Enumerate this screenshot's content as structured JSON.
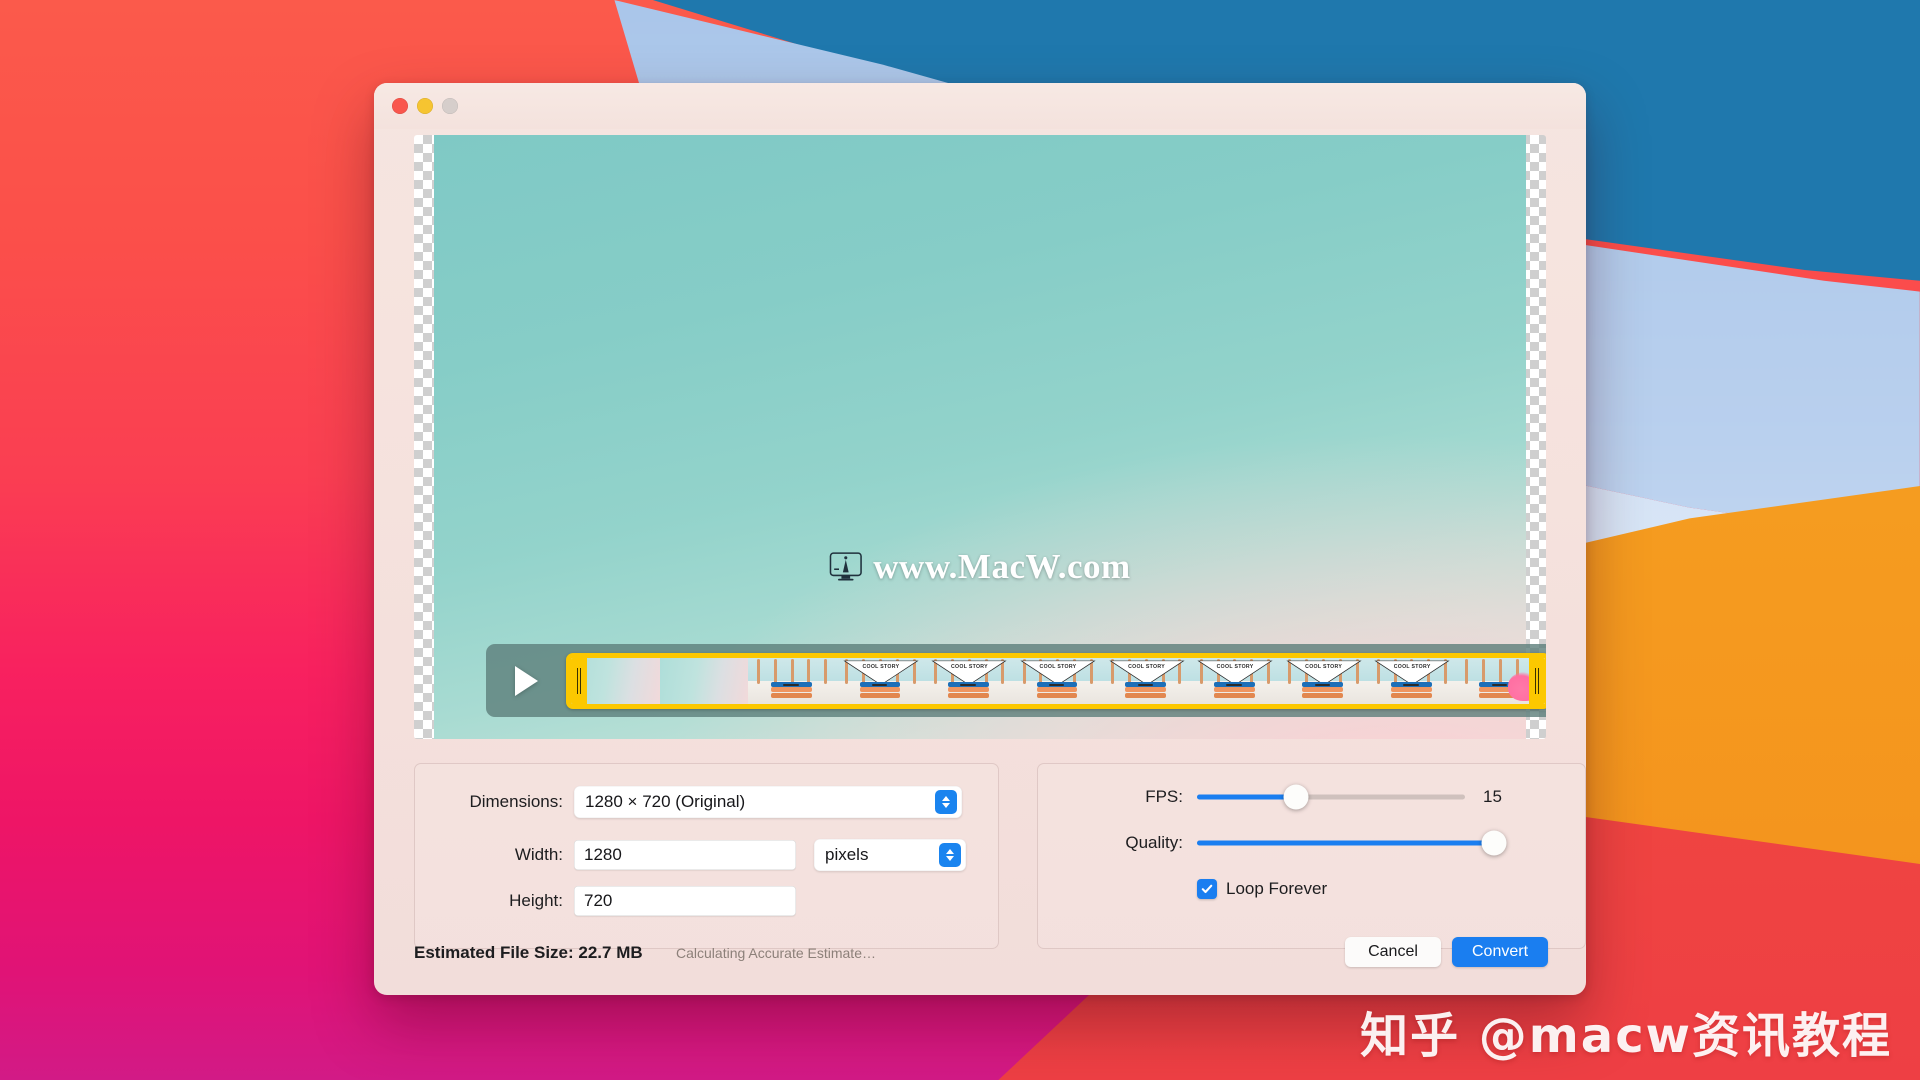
{
  "desktop": {
    "wallpaper_name": "macos-big-sur-wallpaper",
    "colors": {
      "left_top": "#fb5a4b",
      "left_bottom": "#d21a86",
      "blue_dark": "#1f78ad",
      "blue_light": "#c3d7f0",
      "orange": "#f6a623",
      "red_right": "#f25041"
    }
  },
  "window": {
    "traffic_lights": [
      {
        "name": "close",
        "color": "#f9564d"
      },
      {
        "name": "minimize",
        "color": "#f6c431"
      },
      {
        "name": "zoom",
        "color": "#d6cecb"
      }
    ],
    "background": "#f3e0db"
  },
  "preview": {
    "watermark_text": "www.MacW.com",
    "watermark_icon": "imac-monitor-icon",
    "gradient_from": "#7fc9c5",
    "gradient_to": "#d9e6de"
  },
  "timeline": {
    "play_icon": "play-triangle-icon",
    "trim_left_name": "trim-handle-left",
    "trim_right_name": "trim-handle-right",
    "selection_color": "#fcc800",
    "frame_count": 11,
    "frame_caption": "COOL STORY"
  },
  "options": {
    "dimensions": {
      "label": "Dimensions:",
      "value": "1280 × 720 (Original)"
    },
    "width": {
      "label": "Width:",
      "value": "1280"
    },
    "height": {
      "label": "Height:",
      "value": "720"
    },
    "units": {
      "value": "pixels"
    },
    "fps": {
      "label": "FPS:",
      "value": "15",
      "percent": 37
    },
    "quality": {
      "label": "Quality:",
      "percent": 97
    },
    "loop": {
      "label": "Loop Forever",
      "checked": true
    },
    "accent_color": "#1a7ef0"
  },
  "footer": {
    "estimate_label": "Estimated File Size: 22.7 MB",
    "estimate_status": "Calculating Accurate Estimate…",
    "cancel_label": "Cancel",
    "convert_label": "Convert"
  },
  "overlay": {
    "zhihu_watermark": "知乎 @macw资讯教程"
  }
}
